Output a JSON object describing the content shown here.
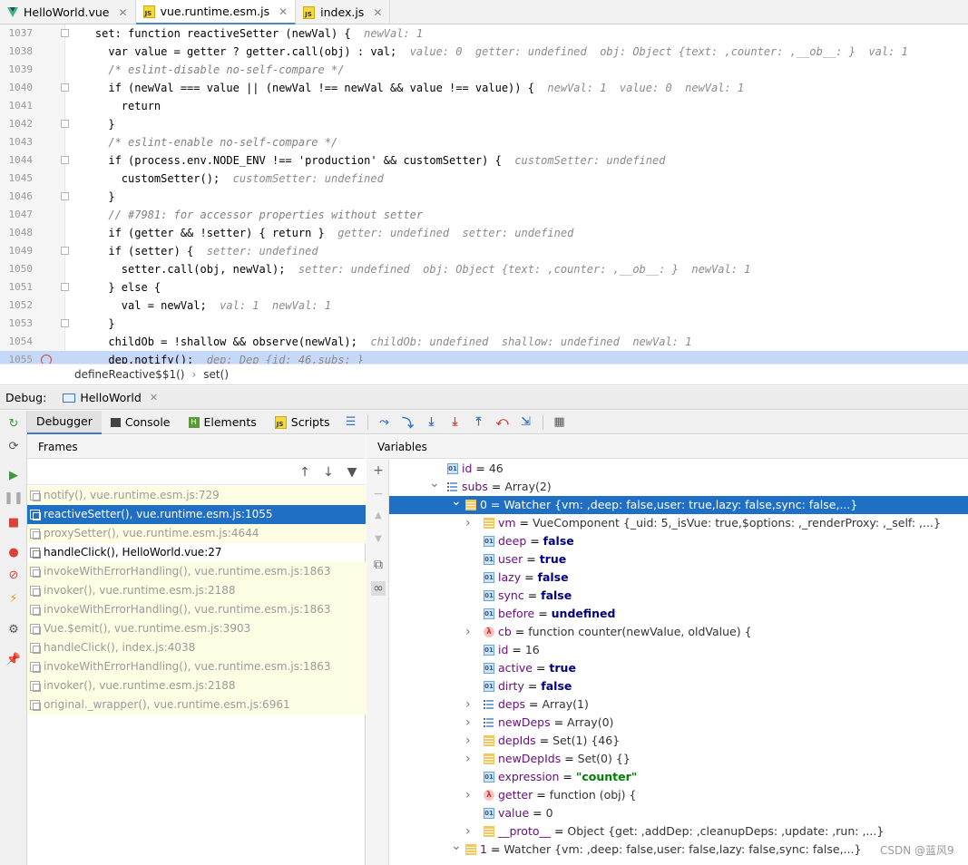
{
  "tabs": [
    {
      "label": "HelloWorld.vue",
      "icon": "vue-icon",
      "active": false
    },
    {
      "label": "vue.runtime.esm.js",
      "icon": "js-icon",
      "active": true
    },
    {
      "label": "index.js",
      "icon": "js-icon",
      "active": false
    }
  ],
  "editor": {
    "lines": [
      {
        "num": "1037",
        "code": "    set: function reactiveSetter (newVal) {",
        "hint": "newVal: 1"
      },
      {
        "num": "1038",
        "code": "      var value = getter ? getter.call(obj) : val;",
        "hint": "value: 0  getter: undefined  obj: Object {text: ,counter: ,__ob__: }  val: 1"
      },
      {
        "num": "1039",
        "code": "      /* eslint-disable no-self-compare */",
        "hint": ""
      },
      {
        "num": "1040",
        "code": "      if (newVal === value || (newVal !== newVal && value !== value)) {",
        "hint": "newVal: 1  value: 0  newVal: 1"
      },
      {
        "num": "1041",
        "code": "        return",
        "hint": ""
      },
      {
        "num": "1042",
        "code": "      }",
        "hint": ""
      },
      {
        "num": "1043",
        "code": "      /* eslint-enable no-self-compare */",
        "hint": ""
      },
      {
        "num": "1044",
        "code": "      if (process.env.NODE_ENV !== 'production' && customSetter) {",
        "hint": "customSetter: undefined"
      },
      {
        "num": "1045",
        "code": "        customSetter();",
        "hint": "customSetter: undefined"
      },
      {
        "num": "1046",
        "code": "      }",
        "hint": ""
      },
      {
        "num": "1047",
        "code": "      // #7981: for accessor properties without setter",
        "hint": ""
      },
      {
        "num": "1048",
        "code": "      if (getter && !setter) { return }",
        "hint": "getter: undefined  setter: undefined"
      },
      {
        "num": "1049",
        "code": "      if (setter) {",
        "hint": "setter: undefined"
      },
      {
        "num": "1050",
        "code": "        setter.call(obj, newVal);",
        "hint": "setter: undefined  obj: Object {text: ,counter: ,__ob__: }  newVal: 1"
      },
      {
        "num": "1051",
        "code": "      } else {",
        "hint": ""
      },
      {
        "num": "1052",
        "code": "        val = newVal;",
        "hint": "val: 1  newVal: 1"
      },
      {
        "num": "1053",
        "code": "      }",
        "hint": ""
      },
      {
        "num": "1054",
        "code": "      childOb = !shallow && observe(newVal);",
        "hint": "childOb: undefined  shallow: undefined  newVal: 1"
      },
      {
        "num": "1055",
        "code": "      dep.notify();",
        "hint": "dep: Dep {id: 46,subs: }"
      }
    ]
  },
  "breadcrumb": {
    "first": "defineReactive$$1()",
    "sep": "›",
    "second": "set()"
  },
  "debug": {
    "label": "Debug:",
    "session": "HelloWorld",
    "tabs": [
      "Debugger",
      "Console",
      "Elements",
      "Scripts"
    ]
  },
  "frames": {
    "title": "Frames",
    "items": [
      {
        "label": "notify(), vue.runtime.esm.js:729",
        "kind": "lib"
      },
      {
        "label": "reactiveSetter(), vue.runtime.esm.js:1055",
        "kind": "sel"
      },
      {
        "label": "proxySetter(), vue.runtime.esm.js:4644",
        "kind": "lib"
      },
      {
        "label": "handleClick(), HelloWorld.vue:27",
        "kind": "user"
      },
      {
        "label": "invokeWithErrorHandling(), vue.runtime.esm.js:1863",
        "kind": "lib"
      },
      {
        "label": "invoker(), vue.runtime.esm.js:2188",
        "kind": "lib"
      },
      {
        "label": "invokeWithErrorHandling(), vue.runtime.esm.js:1863",
        "kind": "lib"
      },
      {
        "label": "Vue.$emit(), vue.runtime.esm.js:3903",
        "kind": "lib"
      },
      {
        "label": "handleClick(), index.js:4038",
        "kind": "lib"
      },
      {
        "label": "invokeWithErrorHandling(), vue.runtime.esm.js:1863",
        "kind": "lib"
      },
      {
        "label": "invoker(), vue.runtime.esm.js:2188",
        "kind": "lib"
      },
      {
        "label": "original._wrapper(), vue.runtime.esm.js:6961",
        "kind": "lib"
      }
    ]
  },
  "variables": {
    "title": "Variables",
    "items": [
      {
        "name": "id",
        "eq": " = ",
        "value": "46",
        "icon": "ic-01",
        "indent": 0,
        "arrow": ""
      },
      {
        "name": "subs",
        "eq": " = ",
        "value": "Array(2)",
        "icon": "ic-arr",
        "indent": 0,
        "arrow": "down"
      },
      {
        "name": "0",
        "eq": " = ",
        "value": "Watcher {vm: ,deep: false,user: true,lazy: false,sync: false,...}",
        "icon": "ic-obj",
        "indent": 1,
        "arrow": "down",
        "sel": true
      },
      {
        "name": "vm",
        "eq": " = ",
        "value": "VueComponent {_uid: 5,_isVue: true,$options: ,_renderProxy: ,_self: ,...}",
        "icon": "ic-obj",
        "indent": 2,
        "arrow": "right"
      },
      {
        "name": "deep",
        "eq": " = ",
        "value": "false",
        "icon": "ic-01",
        "indent": 2,
        "arrow": "",
        "bold": true
      },
      {
        "name": "user",
        "eq": " = ",
        "value": "true",
        "icon": "ic-01",
        "indent": 2,
        "arrow": "",
        "bold": true
      },
      {
        "name": "lazy",
        "eq": " = ",
        "value": "false",
        "icon": "ic-01",
        "indent": 2,
        "arrow": "",
        "bold": true
      },
      {
        "name": "sync",
        "eq": " = ",
        "value": "false",
        "icon": "ic-01",
        "indent": 2,
        "arrow": "",
        "bold": true
      },
      {
        "name": "before",
        "eq": " = ",
        "value": "undefined",
        "icon": "ic-01",
        "indent": 2,
        "arrow": "",
        "bold": true
      },
      {
        "name": "cb",
        "eq": " = ",
        "value": "function counter(newValue, oldValue) {",
        "icon": "ic-fn",
        "indent": 2,
        "arrow": "right"
      },
      {
        "name": "id",
        "eq": " = ",
        "value": "16",
        "icon": "ic-01",
        "indent": 2,
        "arrow": ""
      },
      {
        "name": "active",
        "eq": " = ",
        "value": "true",
        "icon": "ic-01",
        "indent": 2,
        "arrow": "",
        "bold": true
      },
      {
        "name": "dirty",
        "eq": " = ",
        "value": "false",
        "icon": "ic-01",
        "indent": 2,
        "arrow": "",
        "bold": true
      },
      {
        "name": "deps",
        "eq": " = ",
        "value": "Array(1)",
        "icon": "ic-arr",
        "indent": 2,
        "arrow": "right"
      },
      {
        "name": "newDeps",
        "eq": " = ",
        "value": "Array(0)",
        "icon": "ic-arr",
        "indent": 2,
        "arrow": "right"
      },
      {
        "name": "depIds",
        "eq": " = ",
        "value": "Set(1) {46}",
        "icon": "ic-obj",
        "indent": 2,
        "arrow": "right"
      },
      {
        "name": "newDepIds",
        "eq": " = ",
        "value": "Set(0) {}",
        "icon": "ic-obj",
        "indent": 2,
        "arrow": "right"
      },
      {
        "name": "expression",
        "eq": " = ",
        "value": "\"counter\"",
        "icon": "ic-01",
        "indent": 2,
        "arrow": "",
        "str": true
      },
      {
        "name": "getter",
        "eq": " = ",
        "value": "function (obj) {",
        "icon": "ic-fn",
        "indent": 2,
        "arrow": "right"
      },
      {
        "name": "value",
        "eq": " = ",
        "value": "0",
        "icon": "ic-01",
        "indent": 2,
        "arrow": ""
      },
      {
        "name": "__proto__",
        "eq": " = ",
        "value": "Object {get: ,addDep: ,cleanupDeps: ,update: ,run: ,...}",
        "icon": "ic-obj",
        "indent": 2,
        "arrow": "right"
      },
      {
        "name": "1",
        "eq": " = ",
        "value": "Watcher {vm: ,deep: false,user: false,lazy: false,sync: false,...}",
        "icon": "ic-obj",
        "indent": 1,
        "arrow": "down"
      }
    ]
  },
  "watermark": "CSDN @蓝风9"
}
